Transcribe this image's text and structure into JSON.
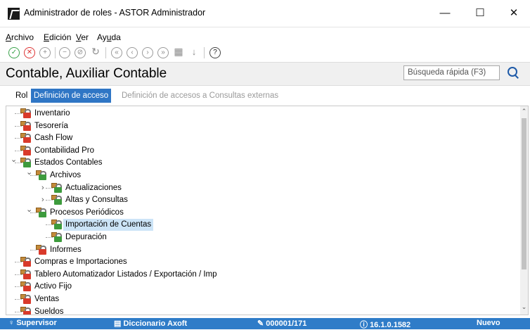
{
  "window": {
    "title": "Administrador de roles - ASTOR Administrador",
    "minimize": "—",
    "maximize": "☐",
    "close": "✕"
  },
  "menu": {
    "items": [
      {
        "label": "Archivo",
        "mnemonic": "A",
        "rest": "rchivo"
      },
      {
        "label": "Edición",
        "mnemonic": "E",
        "rest": "dición"
      },
      {
        "label": "Ver",
        "mnemonic": "V",
        "rest": "er"
      },
      {
        "label": "Ayuda",
        "mnemonic": "u",
        "pre": "Ay",
        "rest": "da"
      }
    ]
  },
  "toolbar": {
    "icons": [
      "ok-icon",
      "cancel-icon",
      "add-icon",
      "remove-icon",
      "block-icon",
      "refresh-icon",
      "first-icon",
      "prev-icon",
      "next-icon",
      "last-icon",
      "grid-icon",
      "sort-icon",
      "help-icon"
    ],
    "glyphs": [
      "✓",
      "✕",
      "+",
      "−",
      "⊘",
      "↻",
      "«",
      "‹",
      "›",
      "»",
      "▦",
      "↓",
      "?"
    ]
  },
  "header": {
    "title": "Contable, Auxiliar Contable",
    "search_placeholder": "Búsqueda rápida (F3)"
  },
  "tabs": [
    {
      "label": "Rol",
      "state": "normal"
    },
    {
      "label": "Definición de acceso",
      "state": "active"
    },
    {
      "label": "Definición de accesos a Consultas externas",
      "state": "disabled"
    }
  ],
  "tree": [
    {
      "label": "Inventario",
      "level": 0,
      "lock": "red"
    },
    {
      "label": "Tesorería",
      "level": 0,
      "lock": "red"
    },
    {
      "label": "Cash Flow",
      "level": 0,
      "lock": "red"
    },
    {
      "label": "Contabilidad Pro",
      "level": 0,
      "lock": "red"
    },
    {
      "label": "Estados Contables",
      "level": 0,
      "lock": "green",
      "expander": "expanded"
    },
    {
      "label": "Archivos",
      "level": 1,
      "lock": "green",
      "expander": "expanded"
    },
    {
      "label": "Actualizaciones",
      "level": 2,
      "lock": "green",
      "expander": "collapsed"
    },
    {
      "label": "Altas y Consultas",
      "level": 2,
      "lock": "green",
      "expander": "collapsed"
    },
    {
      "label": "Procesos Periódicos",
      "level": 1,
      "lock": "green",
      "expander": "expanded"
    },
    {
      "label": "Importación de Cuentas",
      "level": 2,
      "lock": "green",
      "selected": true
    },
    {
      "label": "Depuración",
      "level": 2,
      "lock": "green"
    },
    {
      "label": "Informes",
      "level": 1,
      "lock": "red"
    },
    {
      "label": "Compras e Importaciones",
      "level": 0,
      "lock": "red"
    },
    {
      "label": "Tablero Automatizador Listados / Exportación / Imp",
      "level": 0,
      "lock": "red"
    },
    {
      "label": "Activo Fijo",
      "level": 0,
      "lock": "red"
    },
    {
      "label": "Ventas",
      "level": 0,
      "lock": "red"
    },
    {
      "label": "Sueldos",
      "level": 0,
      "lock": "red"
    }
  ],
  "status": {
    "user": "Supervisor",
    "dictionary": "Diccionario Axoft",
    "record": "000001/171",
    "version": "16.1.0.1582",
    "mode": "Nuevo"
  },
  "colors": {
    "accent": "#2f76c5",
    "status_bg": "#2f7cc8",
    "lock_red": "#d93a2b",
    "lock_green": "#3d9b3d",
    "selection": "#cce4f7"
  }
}
